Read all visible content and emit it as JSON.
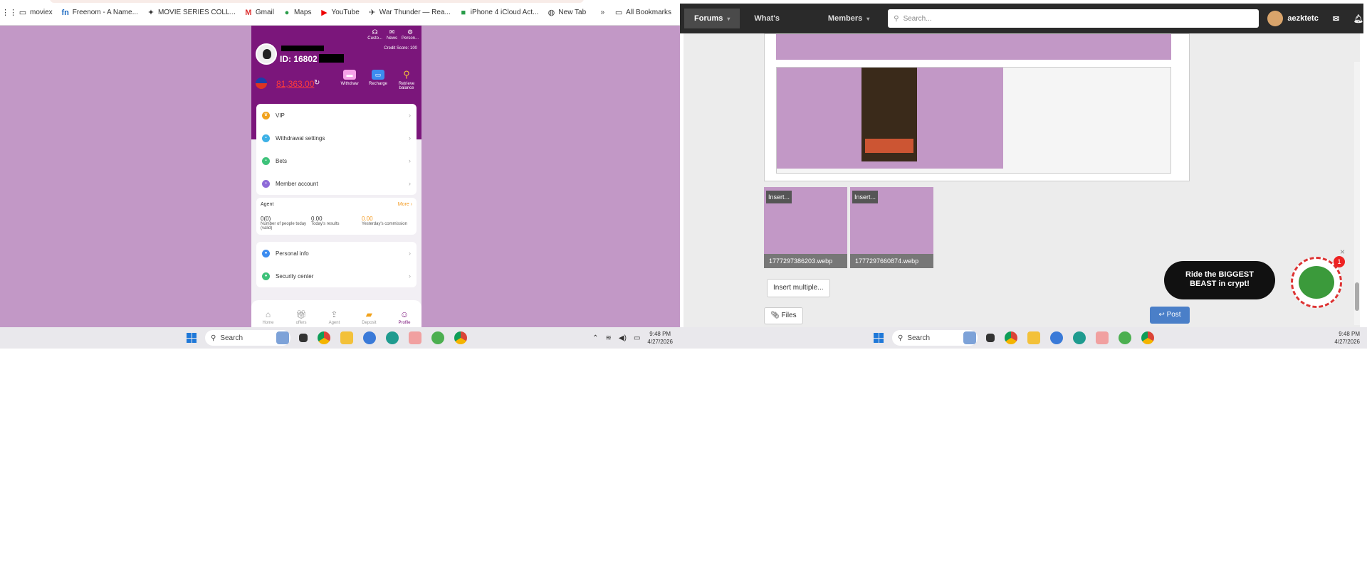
{
  "bookmarks": {
    "items": [
      "moviex",
      "Freenom - A Name...",
      "MOVIE SERIES COLL...",
      "Gmail",
      "Maps",
      "YouTube",
      "War Thunder — Rea...",
      "iPhone 4 iCloud Act...",
      "New Tab"
    ],
    "more": "»",
    "all_bookmarks": "All Bookmarks"
  },
  "phone": {
    "header_icons": [
      "Custo...",
      "News",
      "Person..."
    ],
    "user_id": "ID: 16802",
    "credit_score": "Credit Score: 100",
    "balance": "81,363.00",
    "actions": [
      "Withdraw",
      "Recharge",
      "Retrieve balance"
    ],
    "menu": [
      "VIP",
      "Withdrawal settings",
      "Bets",
      "Member account"
    ],
    "agent": {
      "title": "Agent",
      "more": "More",
      "stats": [
        {
          "value": "0(0)",
          "label": "Number of people today (valid)"
        },
        {
          "value": "0.00",
          "label": "Today's results"
        },
        {
          "value": "0.00",
          "label": "Yesterday's commission"
        }
      ]
    },
    "menu2": [
      "Personal info",
      "Security center"
    ],
    "nav": [
      "Home",
      "offers",
      "Agent",
      "Deposit",
      "Profile"
    ]
  },
  "taskbar": {
    "search": "Search",
    "time": "9:48 PM",
    "date": "4/27/2026"
  },
  "forum": {
    "nav": [
      "Forums",
      "What's new",
      "Members"
    ],
    "search_placeholder": "Search...",
    "username": "aezktetc",
    "thumbs": [
      {
        "insert": "Insert...",
        "filename": "1777297386203.webp"
      },
      {
        "insert": "Insert...",
        "filename": "1777297660874.webp"
      }
    ],
    "insert_multiple": "Insert multiple...",
    "files": "Files",
    "post": "Post",
    "ad_line1": "Ride the BIGGEST",
    "ad_line2": "BEAST in crypt!",
    "ad_badge": "1",
    "close": "×"
  },
  "colors": {
    "purple_bg": "#c298c6",
    "phone_header": "#7b167b",
    "balance": "#ff3b3b",
    "post_button": "#4a7fc8"
  }
}
